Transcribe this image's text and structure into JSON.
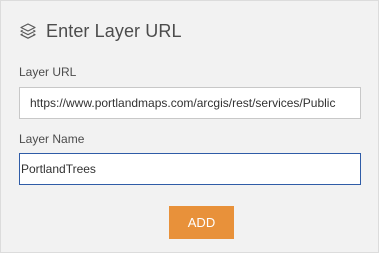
{
  "header": {
    "icon": "layers-icon",
    "title": "Enter Layer URL"
  },
  "form": {
    "layer_url": {
      "label": "Layer URL",
      "value": "https://www.portlandmaps.com/arcgis/rest/services/Public"
    },
    "layer_name": {
      "label": "Layer Name",
      "value": "PortlandTrees"
    },
    "add_button_label": "ADD"
  },
  "colors": {
    "panel_background": "#f2f2f2",
    "text": "#4c4c4c",
    "focused_border": "#2f5ca7",
    "button": "#e8913a"
  }
}
